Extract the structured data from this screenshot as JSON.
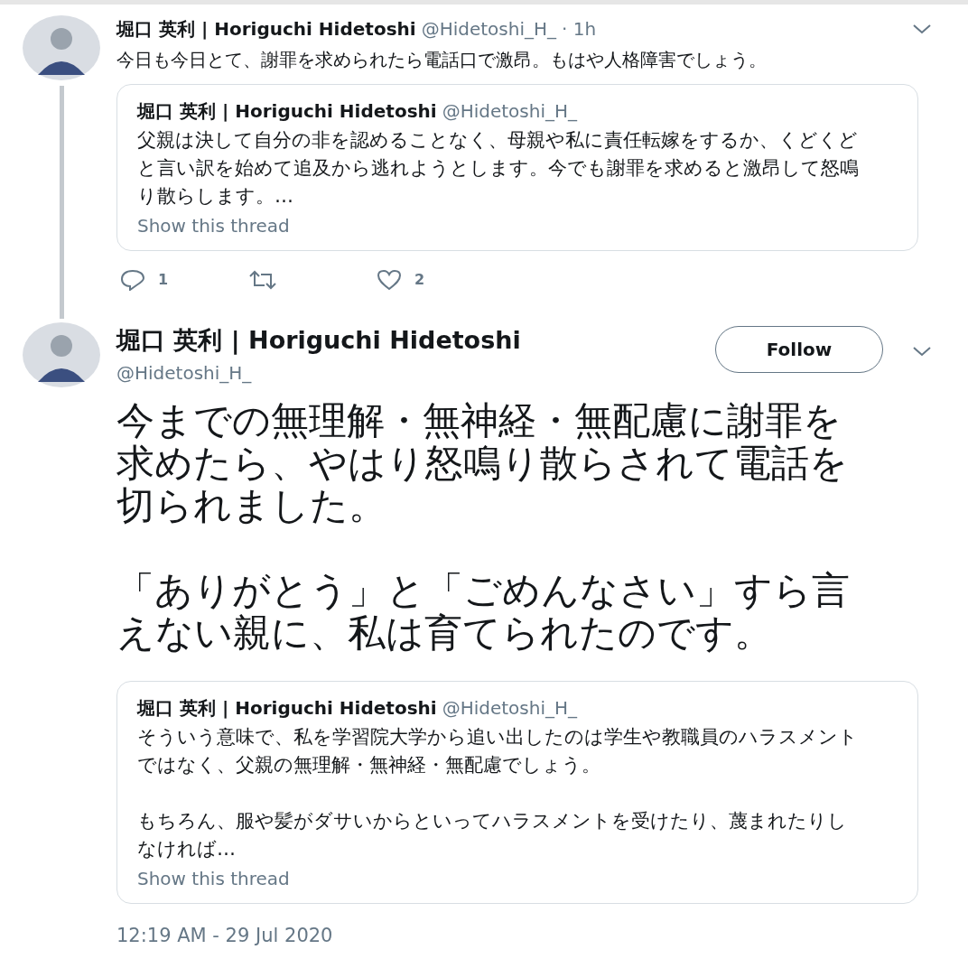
{
  "reply_tweet": {
    "name": "堀口 英利 | Horiguchi Hidetoshi",
    "handle": "@Hidetoshi_H_",
    "time": "· 1h",
    "text": "今日も今日とて、謝罪を求められたら電話口で激昂。もはや人格障害でしょう。",
    "quote": {
      "name": "堀口 英利 | Horiguchi Hidetoshi",
      "handle": "@Hidetoshi_H_",
      "text": "父親は決して自分の非を認めることなく、母親や私に責任転嫁をするか、くどくどと言い訳を始めて追及から逃れようとします。今でも謝罪を求めると激昂して怒鳴り散らします。…",
      "link": "Show this thread"
    },
    "actions": [
      {
        "kind": "reply",
        "count": "1"
      },
      {
        "kind": "retweet"
      },
      {
        "kind": "like",
        "count": "2"
      }
    ]
  },
  "main_tweet": {
    "name": "堀口 英利 | Horiguchi Hidetoshi",
    "handle": "@Hidetoshi_H_",
    "follow_button": "Follow",
    "paragraphs": [
      "今までの無理解・無神経・無配慮に謝罪を求めたら、やはり怒鳴り散らされて電話を切られました。",
      "「ありがとう」と「ごめんなさい」すら言えない親に、私は育てられたのです。"
    ],
    "quote": {
      "name": "堀口 英利 | Horiguchi Hidetoshi",
      "handle": "@Hidetoshi_H_",
      "paragraphs": [
        "そういう意味で、私を学習院大学から追い出したのは学生や教職員のハラスメントではなく、父親の無理解・無神経・無配慮でしょう。",
        "もちろん、服や髪がダサいからといってハラスメントを受けたり、蔑まれたりしなければ…"
      ],
      "link": "Show this thread"
    },
    "timestamp": "12:19 AM - 29 Jul 2020"
  }
}
